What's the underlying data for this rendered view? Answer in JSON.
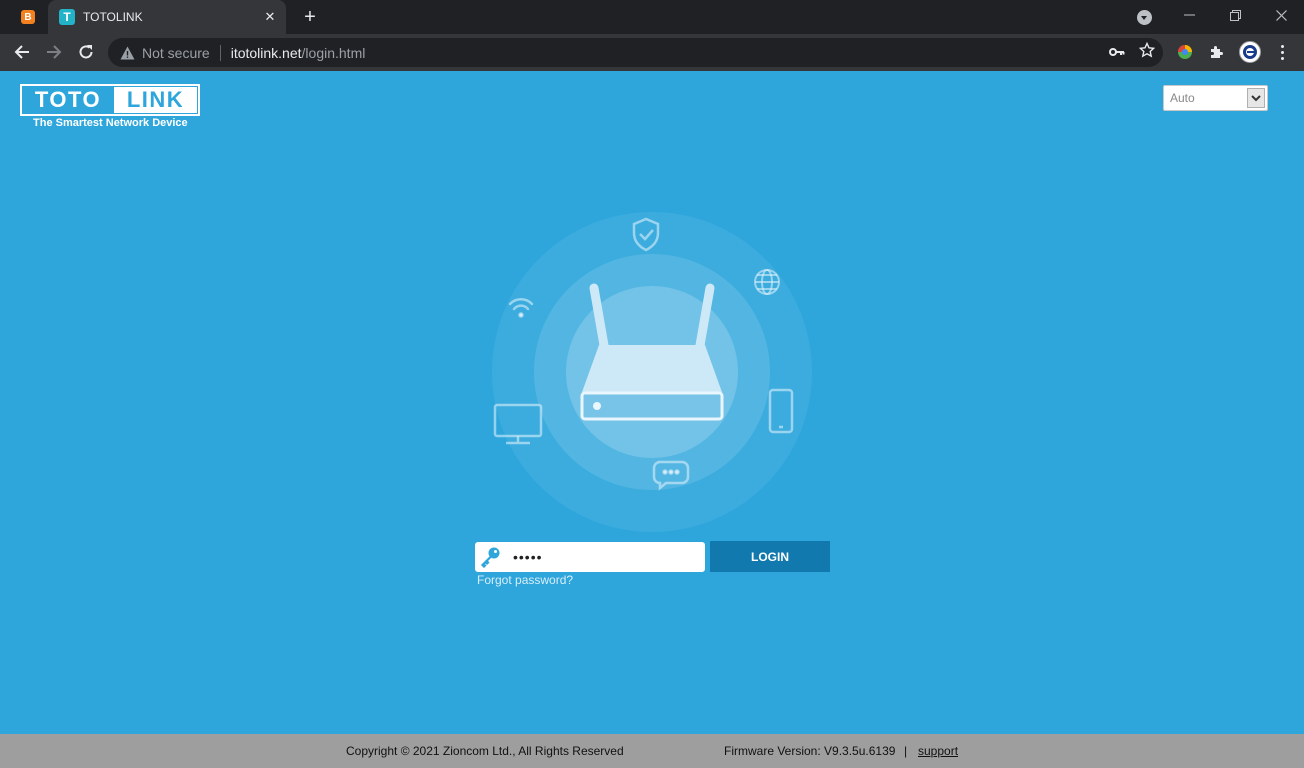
{
  "browser": {
    "tabs": [
      {
        "label": "",
        "icon": "blogger-icon"
      },
      {
        "label": "TOTOLINK",
        "icon": "totolink-favicon",
        "favicon_letter": "T"
      }
    ],
    "blogger_letter": "B",
    "address": {
      "security_label": "Not secure",
      "host": "itotolink.net",
      "path": "/login.html"
    }
  },
  "header": {
    "logo_left": "TOTO",
    "logo_right": "LINK",
    "tagline": "The Smartest Network Device",
    "language": {
      "selected": "Auto"
    }
  },
  "login": {
    "password_value": "•••••",
    "login_label": "LOGIN",
    "forgot_label": "Forgot password?"
  },
  "footer": {
    "copyright": "Copyright © 2021 Zioncom Ltd., All Rights Reserved",
    "firmware": "Firmware Version: V9.3.5u.6139",
    "separator": "|",
    "support_label": "support"
  },
  "colors": {
    "page_bg": "#2ea6dc",
    "login_button": "#1179ae",
    "footer_bg": "#9e9e9e"
  }
}
